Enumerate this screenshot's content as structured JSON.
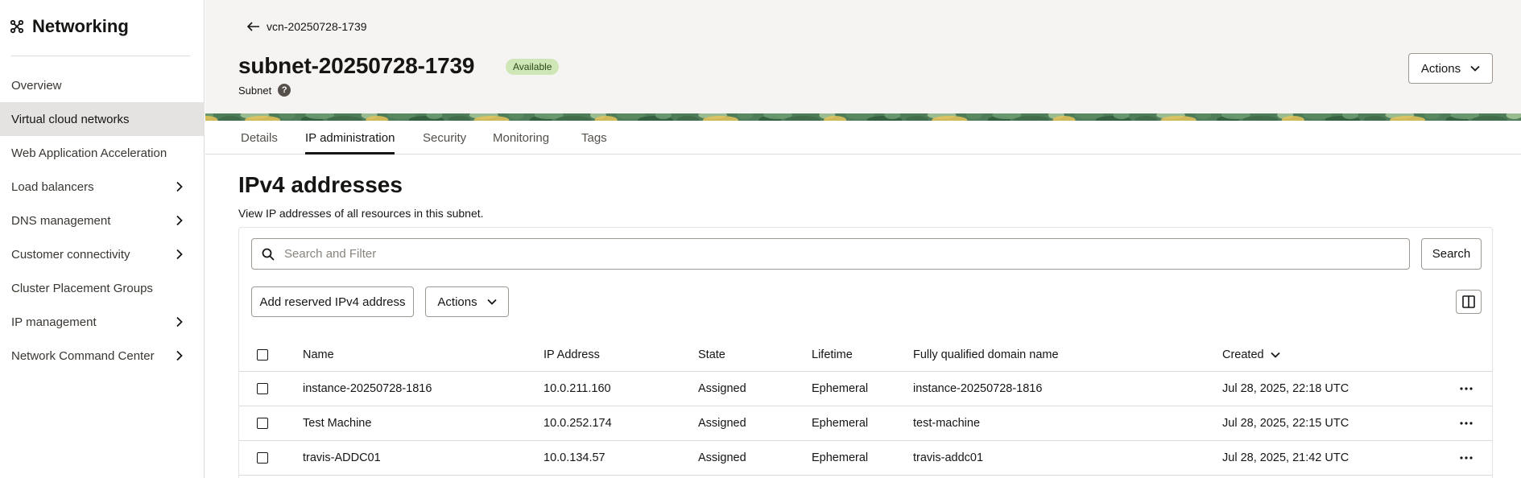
{
  "sidebar": {
    "title": "Networking",
    "items": [
      {
        "label": "Overview",
        "has_children": false,
        "active": false
      },
      {
        "label": "Virtual cloud networks",
        "has_children": false,
        "active": true
      },
      {
        "label": "Web Application Acceleration",
        "has_children": false,
        "active": false
      },
      {
        "label": "Load balancers",
        "has_children": true,
        "active": false
      },
      {
        "label": "DNS management",
        "has_children": true,
        "active": false
      },
      {
        "label": "Customer connectivity",
        "has_children": true,
        "active": false
      },
      {
        "label": "Cluster Placement Groups",
        "has_children": false,
        "active": false
      },
      {
        "label": "IP management",
        "has_children": true,
        "active": false
      },
      {
        "label": "Network Command Center",
        "has_children": true,
        "active": false
      }
    ]
  },
  "header": {
    "back_label": "vcn-20250728-1739",
    "title": "subnet-20250728-1739",
    "status": "Available",
    "subtitle": "Subnet",
    "help_label": "?",
    "actions_label": "Actions"
  },
  "tabs": [
    {
      "label": "Details",
      "active": false
    },
    {
      "label": "IP administration",
      "active": true
    },
    {
      "label": "Security",
      "active": false
    },
    {
      "label": "Monitoring",
      "active": false
    },
    {
      "label": "Tags",
      "active": false
    }
  ],
  "main": {
    "section_title": "IPv4 addresses",
    "section_desc": "View IP addresses of all resources in this subnet.",
    "search_placeholder": "Search and Filter",
    "search_button": "Search",
    "add_button": "Add reserved IPv4 address",
    "actions_button": "Actions"
  },
  "table": {
    "columns": [
      "Name",
      "IP Address",
      "State",
      "Lifetime",
      "Fully qualified domain name",
      "Created"
    ],
    "sorted_column": "Created",
    "rows": [
      [
        "instance-20250728-1816",
        "10.0.211.160",
        "Assigned",
        "Ephemeral",
        "instance-20250728-1816",
        "Jul 28, 2025, 22:18 UTC"
      ],
      [
        "Test Machine",
        "10.0.252.174",
        "Assigned",
        "Ephemeral",
        "test-machine",
        "Jul 28, 2025, 22:15 UTC"
      ],
      [
        "travis-ADDC01",
        "10.0.134.57",
        "Assigned",
        "Ephemeral",
        "travis-addc01",
        "Jul 28, 2025, 21:42 UTC"
      ]
    ]
  },
  "colors": {
    "status_badge_bg": "#cfe6b7",
    "status_badge_text": "#2a4b14",
    "active_nav_bg": "#e4e3e1",
    "header_bg": "#f5f4f2"
  }
}
